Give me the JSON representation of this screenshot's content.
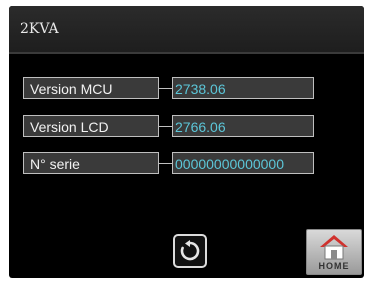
{
  "header": {
    "title": "2KVA"
  },
  "info_rows": [
    {
      "label": "Version MCU",
      "value": "2738.06"
    },
    {
      "label": "Version LCD",
      "value": "2766.06"
    },
    {
      "label": "N° serie",
      "value": "00000000000000"
    }
  ],
  "buttons": {
    "refresh_icon": "refresh-icon",
    "home_icon": "home-icon",
    "home_label": "HOME"
  },
  "colors": {
    "value_text": "#5cc6d8",
    "panel_bg": "#000000",
    "home_roof": "#d0312d"
  }
}
